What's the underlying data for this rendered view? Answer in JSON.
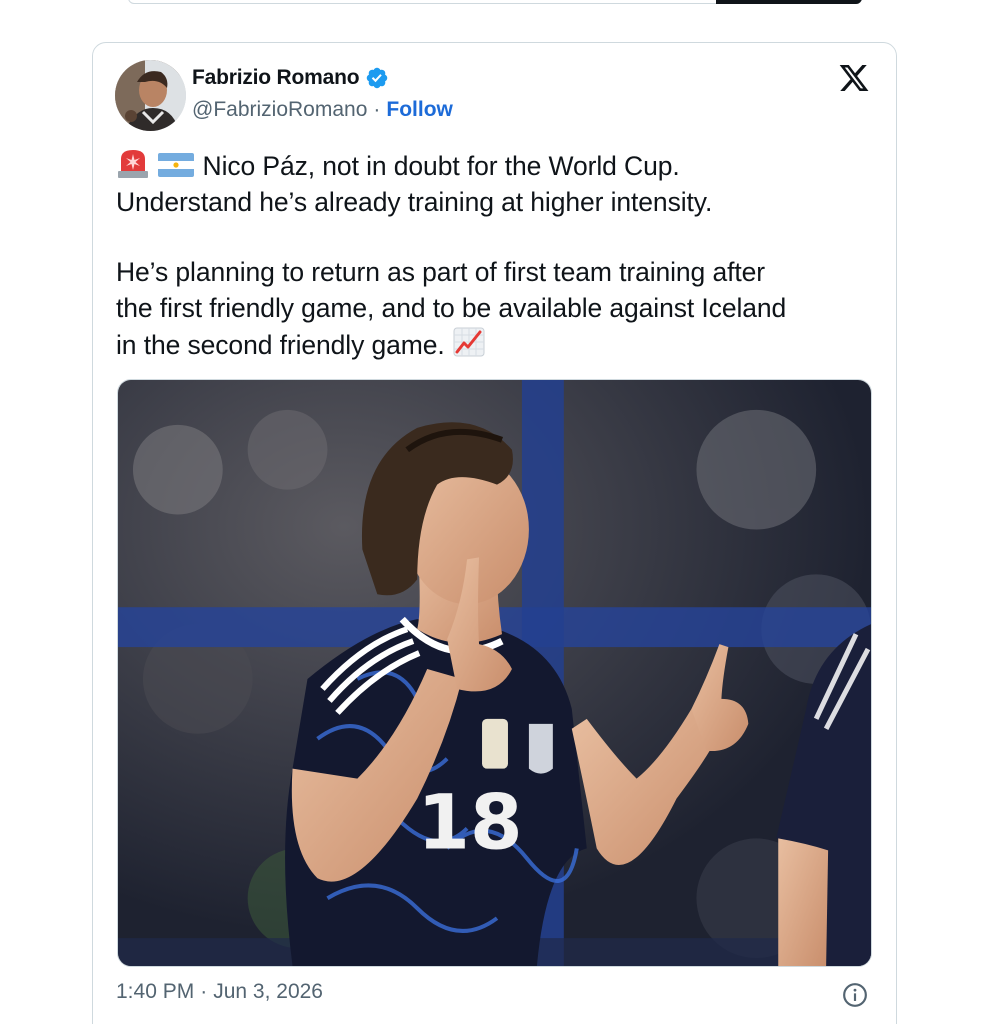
{
  "author": {
    "name": "Fabrizio Romano",
    "handle": "@FabrizioRomano",
    "follow_label": "Follow",
    "avatar_icon": "profile-photo",
    "verified_icon": "verified-badge-icon"
  },
  "platform_icon": "x-logo-icon",
  "tweet": {
    "lead_emojis": [
      "rotating-light-emoji",
      "argentina-flag-emoji"
    ],
    "line1": "Nico Páz, not in doubt for the World Cup.",
    "line2": "Understand he’s already training at higher intensity.",
    "line3": "He’s planning to return as part of first team training after",
    "line4": "the first friendly game, and to be available against Iceland",
    "line5": "in the second friendly game.",
    "trail_emoji": "chart-increasing-emoji"
  },
  "media": {
    "type": "photo",
    "jersey_number": "18"
  },
  "footer": {
    "time": "1:40 PM",
    "separator": "·",
    "date": "Jun 3, 2026",
    "info_icon": "info-icon"
  },
  "colors": {
    "follow": "#1d6bd8",
    "verified": "#1d9bf0",
    "secondary_text": "#536471",
    "border": "#cfd9de"
  }
}
